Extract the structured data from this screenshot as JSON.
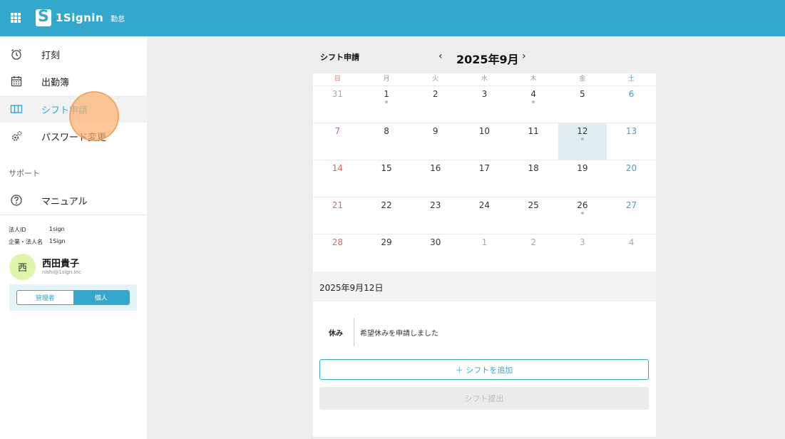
{
  "header": {
    "logo_text": "1Signin",
    "logo_sub": "勤怠"
  },
  "sidebar": {
    "items": [
      {
        "label": "打刻",
        "icon": "alarm-clock-icon"
      },
      {
        "label": "出勤簿",
        "icon": "calendar-icon"
      },
      {
        "label": "シフト申請",
        "icon": "columns-icon",
        "active": true
      },
      {
        "label": "パスワード変更",
        "icon": "gears-icon"
      }
    ],
    "section_support": "サポート",
    "support_items": [
      {
        "label": "マニュアル",
        "icon": "help-circle-icon"
      }
    ]
  },
  "account": {
    "corp_id_label": "法人ID",
    "corp_id_value": "1sign",
    "corp_name_label": "企業・法人名",
    "corp_name_value": "1Sign",
    "avatar_initial": "西",
    "user_name": "西田貴子",
    "user_email": "nishi@1sign.inc",
    "role_admin": "管理者",
    "role_personal": "個人",
    "active_role": "個人"
  },
  "calendar": {
    "section_title": "シフト申請",
    "prev": "‹",
    "next": "›",
    "month": "2025年9月",
    "weekdays": [
      "日",
      "月",
      "火",
      "水",
      "木",
      "金",
      "土"
    ],
    "weeks": [
      [
        {
          "d": "31",
          "muted": true
        },
        {
          "d": "1",
          "dot": true
        },
        {
          "d": "2"
        },
        {
          "d": "3"
        },
        {
          "d": "4",
          "dot": true
        },
        {
          "d": "5"
        },
        {
          "d": "6"
        }
      ],
      [
        {
          "d": "7"
        },
        {
          "d": "8"
        },
        {
          "d": "9"
        },
        {
          "d": "10"
        },
        {
          "d": "11"
        },
        {
          "d": "12",
          "dot": true,
          "selected": true
        },
        {
          "d": "13"
        }
      ],
      [
        {
          "d": "14"
        },
        {
          "d": "15"
        },
        {
          "d": "16"
        },
        {
          "d": "17"
        },
        {
          "d": "18"
        },
        {
          "d": "19"
        },
        {
          "d": "20"
        }
      ],
      [
        {
          "d": "21"
        },
        {
          "d": "22"
        },
        {
          "d": "23"
        },
        {
          "d": "24"
        },
        {
          "d": "25"
        },
        {
          "d": "26",
          "dot": true
        },
        {
          "d": "27"
        }
      ],
      [
        {
          "d": "28"
        },
        {
          "d": "29"
        },
        {
          "d": "30"
        },
        {
          "d": "1",
          "muted": true
        },
        {
          "d": "2",
          "muted": true
        },
        {
          "d": "3",
          "muted": true
        },
        {
          "d": "4",
          "muted": true
        }
      ]
    ],
    "colors": {
      "sunday": "#e56060",
      "saturday": "#33a8cc",
      "selected_bg": "#e0eef3"
    }
  },
  "detail": {
    "date_label": "2025年9月12日",
    "entry_type": "休み",
    "entry_text": "希望休みを申請しました",
    "add_button": "＋ シフトを追加",
    "submit_button": "シフト提出"
  },
  "theme": {
    "accent": "#33a8cc"
  }
}
